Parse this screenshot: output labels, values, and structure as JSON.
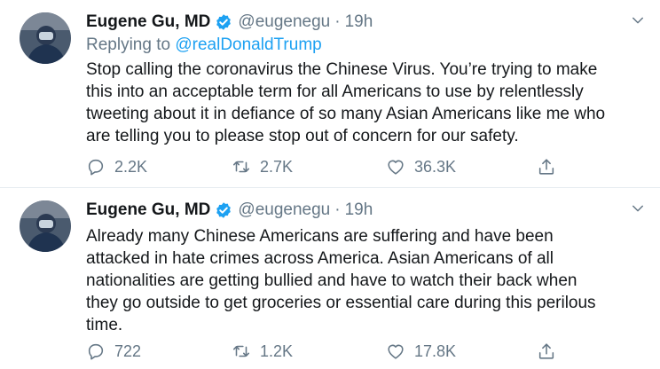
{
  "tweets": [
    {
      "author_name": "Eugene Gu, MD",
      "handle": "@eugenegu",
      "separator": "·",
      "time": "19h",
      "replying_to_label": "Replying to",
      "replying_to_mention": "@realDonaldTrump",
      "text_lines": [
        "Stop calling the coronavirus the Chinese Virus. You’re trying to make",
        "this into an acceptable term for all Americans to use by relentlessly",
        "tweeting about it in defiance of so many Asian Americans like me who",
        "are telling you to please stop out of concern for our safety."
      ],
      "replies": "2.2K",
      "retweets": "2.7K",
      "likes": "36.3K"
    },
    {
      "author_name": "Eugene Gu, MD",
      "handle": "@eugenegu",
      "separator": "·",
      "time": "19h",
      "text_lines": [
        "Already many Chinese Americans are suffering and have been",
        "attacked in hate crimes across America. Asian Americans of all",
        "nationalities are getting bullied and have to watch their back when",
        "they go outside to get groceries or essential care during this perilous",
        "time."
      ],
      "replies": "722",
      "retweets": "1.2K",
      "likes": "17.8K"
    }
  ],
  "icons": {
    "verified": "verified-badge-icon",
    "caret": "chevron-down-icon",
    "reply": "reply-icon",
    "retweet": "retweet-icon",
    "like": "heart-icon",
    "share": "share-icon"
  },
  "colors": {
    "text": "#14171a",
    "muted": "#657786",
    "accent": "#1da1f2",
    "divider": "#e6ecf0"
  }
}
